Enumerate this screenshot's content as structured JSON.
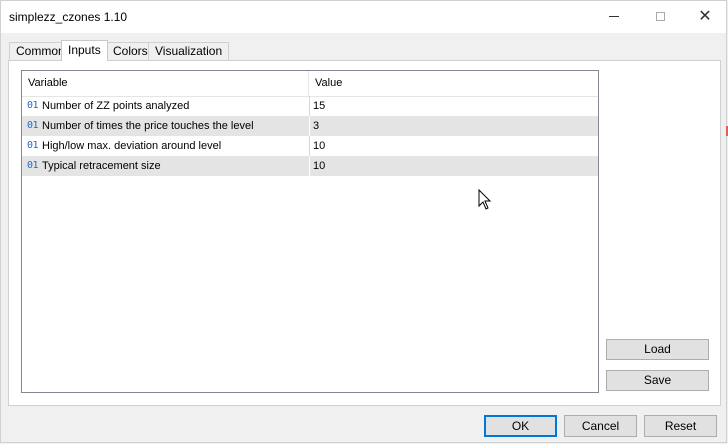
{
  "window": {
    "title": "simplezz_czones 1.10"
  },
  "tabs": [
    {
      "label": "Common"
    },
    {
      "label": "Inputs",
      "active": true
    },
    {
      "label": "Colors"
    },
    {
      "label": "Visualization"
    }
  ],
  "grid": {
    "columns": {
      "variable": "Variable",
      "value": "Value"
    },
    "rows": [
      {
        "type": "01",
        "variable": "Number of ZZ points analyzed",
        "value": "15"
      },
      {
        "type": "01",
        "variable": "Number of times the price touches the level",
        "value": "3"
      },
      {
        "type": "01",
        "variable": "High/low max. deviation around level",
        "value": "10"
      },
      {
        "type": "01",
        "variable": "Typical retracement size",
        "value": "10"
      }
    ]
  },
  "side_buttons": {
    "load": "Load",
    "save": "Save"
  },
  "footer_buttons": {
    "ok": "OK",
    "cancel": "Cancel",
    "reset": "Reset"
  }
}
